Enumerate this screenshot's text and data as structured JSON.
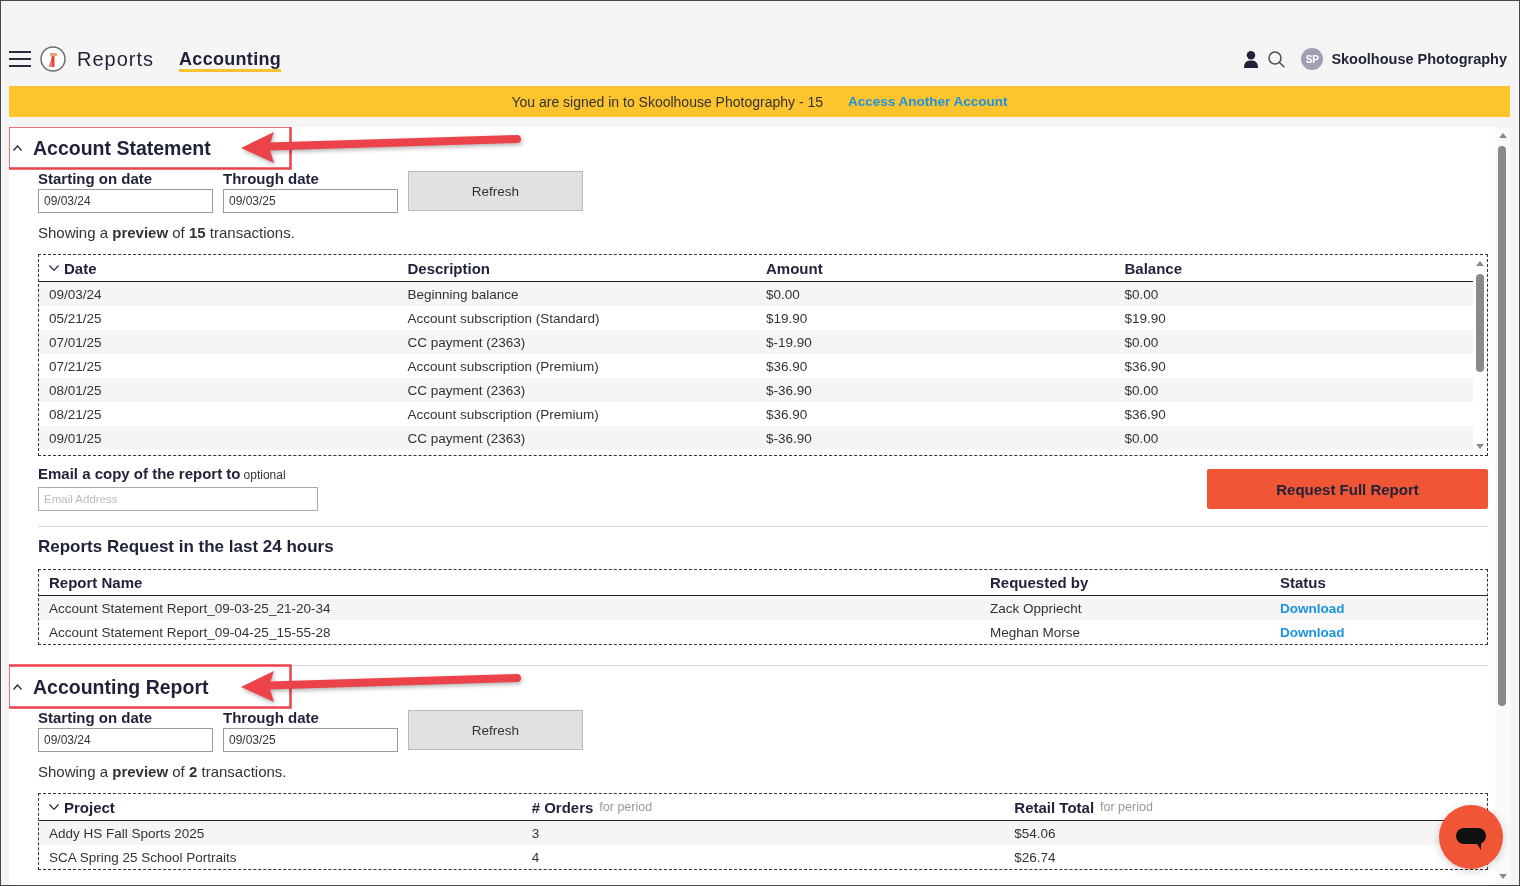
{
  "header": {
    "title": "Reports",
    "tabs": [
      {
        "label": "Accounting",
        "selected": true
      }
    ],
    "avatar_initials": "SP",
    "account_name": "Skoolhouse Photography"
  },
  "banner": {
    "message": "You are signed in to Skoolhouse Photography - 15",
    "link": "Access Another Account"
  },
  "sections": [
    {
      "title": "Account Statement",
      "expanded": true,
      "highlighted": true,
      "start_label": "Starting on date",
      "start_date": "09/03/24",
      "end_label": "Through date",
      "end_date": "09/03/25",
      "refresh_button": "Refresh",
      "summary": "Showing a **preview** of **15** transactions.",
      "table": {
        "scrollable": true,
        "columns": [
          {
            "label": "Date",
            "sorted": true
          },
          {
            "label": "Description",
            "sorted": false
          },
          {
            "label": "Amount",
            "sorted": false
          },
          {
            "label": "Balance",
            "sorted": false
          }
        ],
        "rows": [
          [
            "09/03/24",
            "Beginning balance",
            "$0.00",
            "$0.00"
          ],
          [
            "05/21/25",
            "Account subscription (Standard)",
            "$19.90",
            "$19.90"
          ],
          [
            "07/01/25",
            "CC payment (2363)",
            "$-19.90",
            "$0.00"
          ],
          [
            "07/21/25",
            "Account subscription (Premium)",
            "$36.90",
            "$36.90"
          ],
          [
            "08/01/25",
            "CC payment (2363)",
            "$-36.90",
            "$0.00"
          ],
          [
            "08/21/25",
            "Account subscription (Premium)",
            "$36.90",
            "$36.90"
          ],
          [
            "09/01/25",
            "CC payment (2363)",
            "$-36.90",
            "$0.00"
          ]
        ]
      },
      "email": {
        "label": "Email a copy of the report to",
        "hint": "optional",
        "placeholder": "Email Address"
      },
      "request_button": "Request Full Report",
      "requests": {
        "title": "Reports Request in the last 24 hours",
        "columns": [
          {
            "label": "Report Name",
            "kind": "text"
          },
          {
            "label": "Requested by",
            "kind": "text"
          },
          {
            "label": "Status",
            "kind": "link"
          }
        ],
        "rows": [
          [
            "Account Statement Report_09-03-25_21-20-34",
            "Zack Oppriecht",
            "Download"
          ],
          [
            "Account Statement Report_09-04-25_15-55-28",
            "Meghan Morse",
            "Download"
          ]
        ]
      }
    },
    {
      "title": "Accounting Report",
      "expanded": true,
      "highlighted": true,
      "start_label": "Starting on date",
      "start_date": "09/03/24",
      "end_label": "Through date",
      "end_date": "09/03/25",
      "refresh_button": "Refresh",
      "summary": "Showing a **preview** of **2** transactions.",
      "table": {
        "columns": [
          {
            "label": "Project",
            "sorted": true
          },
          {
            "label": "# Orders",
            "note": "for period",
            "sorted": false
          },
          {
            "label": "Retail Total",
            "note": "for period",
            "sorted": false
          }
        ],
        "rows": [
          [
            "Addy HS Fall Sports 2025",
            "3",
            "$54.06"
          ],
          [
            "SCA Spring 25 School Portraits",
            "4",
            "$26.74"
          ]
        ]
      }
    }
  ]
}
